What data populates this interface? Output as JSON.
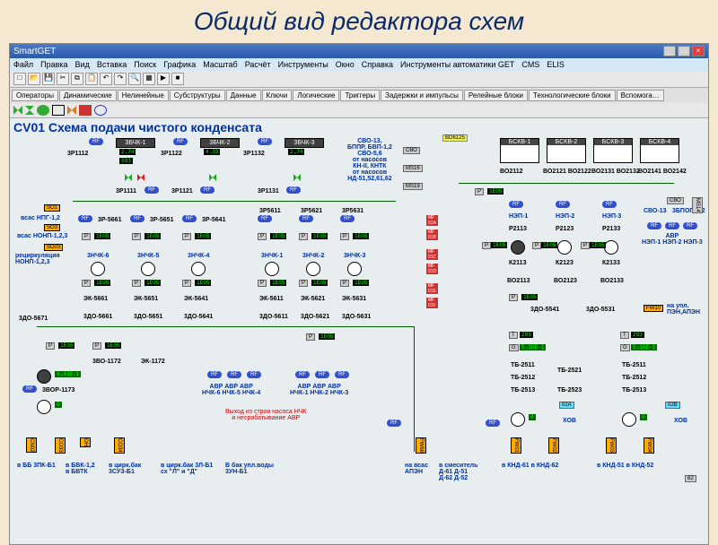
{
  "slide_title": "Общий вид редактора схем",
  "app_title": "SmartGET",
  "window_buttons": {
    "min": "_",
    "max": "□",
    "close": "×"
  },
  "menu": [
    "Файл",
    "Правка",
    "Вид",
    "Вставка",
    "Поиск",
    "Графика",
    "Масштаб",
    "Расчёт",
    "Инструменты",
    "Окно",
    "Справка",
    "Инструменты автоматики GET",
    "CMS",
    "ELIS"
  ],
  "tabs": [
    "Операторы",
    "Динамические",
    "Нелинейные",
    "Субструктуры",
    "Данные",
    "Ключи",
    "Логические",
    "Триггеры",
    "Задержки и импульсы",
    "Релейные блоки",
    "Технологические блоки",
    "Вспомога…"
  ],
  "scheme_title": "CV01 Схема подачи чистого конденсата",
  "top_units": {
    "u1": "3БЧК-1",
    "u2": "3БЧК-2",
    "u3": "3БЧК-3",
    "b1": "БСКВ-1",
    "b2": "БСКВ-2",
    "b3": "БСКВ-3",
    "b4": "БСКВ-4"
  },
  "labels": {
    "l1": "3Р1112",
    "l2": "3Р1122",
    "l3": "3Р1132",
    "l4": "3Р1111",
    "l5": "3Р1121",
    "l6": "3Р1131",
    "sv": "СВО-13,\nБППР, БВП-1,2\nСВО-5,6\nот насосов\nКН-II, КНТК\nот насосов\nНД-51,52,61,62",
    "bo1": "ВО2112",
    "bo2": "ВО2121 ВО2122",
    "bo3": "ВО2131 ВО2132",
    "bo4": "ВО2141 ВО2142",
    "vsas1": "всас НПГ-1,2",
    "vsas2": "всас НОНП-1,2,3",
    "rec": "рециркуляция\nНОНП-1,2,3",
    "r51": "3Р-5661",
    "r52": "3Р-5651",
    "r53": "3Р-5641",
    "r54": "3Р5611",
    "r55": "3Р5621",
    "r56": "3Р5631",
    "n1": "3НЧК-6",
    "n2": "3НЧК-5",
    "n3": "3НЧК-4",
    "n4": "3НЧК-1",
    "n5": "3НЧК-2",
    "n6": "3НЧК-3",
    "e1": "ЭК-5661",
    "e2": "ЭК-5651",
    "e3": "ЭК-5641",
    "e4": "ЭК-5611",
    "e5": "ЭК-5621",
    "e6": "ЭК-5631",
    "z1": "3ДО-5671",
    "z2": "3ДО-5661",
    "z3": "3ДО-5651",
    "z4": "3ДО-5641",
    "z5": "3ДО-5611",
    "z6": "3ДО-5621",
    "z7": "3ДО-5631",
    "ne1": "НЭП-1",
    "ne2": "НЭП-2",
    "ne3": "НЭП-3",
    "p21": "Р2113",
    "p22": "Р2123",
    "p23": "Р2133",
    "k21": "К2113",
    "k22": "К2123",
    "k23": "К2133",
    "bo21": "ВО2113",
    "bo22": "ВО2123",
    "bo23": "ВО2133",
    "zd51": "3ДО-5541",
    "zd52": "3ДО-5531",
    "svo13": "СВО-13",
    "zbpop": "3БПОП-1,2",
    "abr": "АВР\nНЭП-1 НЭП-2 НЭП-3",
    "ek1172": "ЭК-1172",
    "zvo1172": "3ВО-1172",
    "zvor1173": "3ВОР-1173",
    "abrn": "АВР АВР АВР\nНЧК-6 НЧК-5 НЧК-4",
    "abrn2": "АВР АВР АВР\nНЧК-1 НЧК-2 НЧК-3",
    "warn": "Выход из строя насоса НЧК\nи несрабатывание АВР",
    "hov": "ХОВ",
    "upl": "на упл.\nПЭН,АПЭН",
    "tb1": "ТБ-2511",
    "tb2": "ТБ-2512",
    "tb3": "ТБ-2513",
    "ts1": "ТБ-2521",
    "ts2": "ТБ-2523",
    "ts3": "ТБ-2513",
    "bot1": "в ББ 3ПК-Б1",
    "bot2": "в БВК-1,2\nв БВТК",
    "bot3": "в цирк.бак\n3СУЗ-Б1",
    "bot4": "в цирк.бак 3Л-Б1\nсх \"Л\" и \"Д\"",
    "bot5": "В бак упл.воды\n3УН-Б1",
    "bot6": "на всас\nАПЭН",
    "bot7": "в смеситель\nД-61 Д-51\nД-62 Д-52",
    "bot8": "в КНД-61   в КНД-62",
    "bot9": "в КНД-51   в КНД-52"
  },
  "values": {
    "g1": "2.74",
    "g2": "4.33",
    "g3": "2.74",
    "p593": "593",
    "e": "1E05",
    "t293": "293",
    "t5": "5.16E-1",
    "g43": "6.43E-1",
    "z0": "0"
  },
  "btns": {
    "rf": "RF",
    "mf01a": "MF\n01A",
    "mf01b": "MF\n01B",
    "mf01c": "MF\n01C",
    "mf01d": "MF\n01D",
    "mf01e": "MF\n01E",
    "mf01f": "MF\n01F",
    "p": "P",
    "svo": "СВО",
    "ms16": "MS16",
    "ms19": "MS19",
    "so1": "SO1",
    "so3": "SO3",
    "so03": "SO03",
    "bo6125": "ВО6125",
    "fw10": "FW10",
    "fw68": "FW68",
    "fw01": "FW01",
    "fw02": "FW02",
    "fw03": "FW03",
    "fw04": "FW04",
    "o2a": "02A",
    "o2b": "02B",
    "cn02": "CN02",
    "co33": "CO33",
    "oh": "OH",
    "co34": "CO34",
    "t": "T",
    "g": "G",
    "ms14": "MS14",
    "b62": "62"
  }
}
